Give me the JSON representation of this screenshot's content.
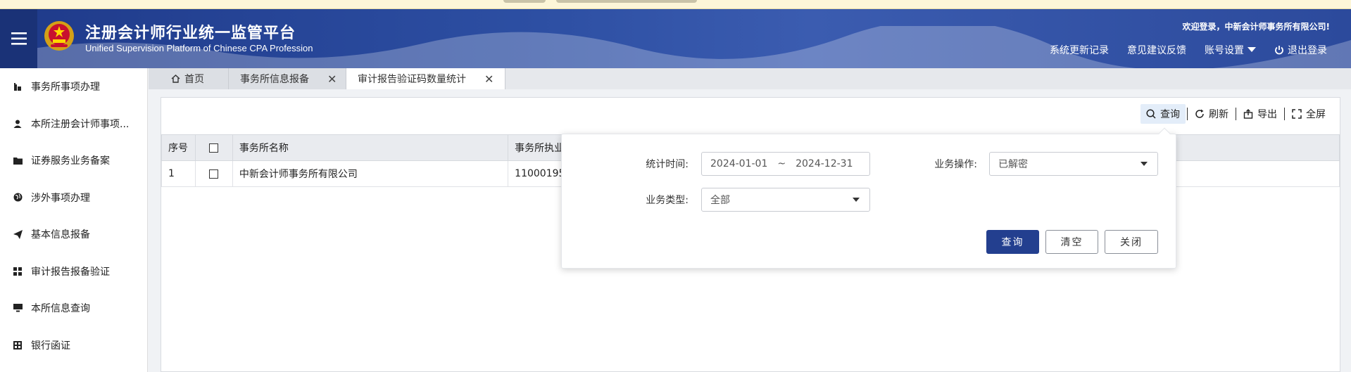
{
  "header": {
    "title_cn": "注册会计师行业统一监管平台",
    "title_en": "Unified Supervision Platform of Chinese CPA Profession",
    "welcome": "欢迎登录，中新会计师事务所有限公司!",
    "nav": [
      {
        "label": "系统更新记录"
      },
      {
        "label": "意见建议反馈"
      },
      {
        "label": "账号设置"
      },
      {
        "label": "退出登录"
      }
    ]
  },
  "sidebar": {
    "items": [
      {
        "label": "事务所事项办理",
        "icon": "building-icon"
      },
      {
        "label": "本所注册会计师事项...",
        "icon": "user-icon"
      },
      {
        "label": "证券服务业务备案",
        "icon": "folder-icon"
      },
      {
        "label": "涉外事项办理",
        "icon": "globe-icon"
      },
      {
        "label": "基本信息报备",
        "icon": "send-icon"
      },
      {
        "label": "审计报告报备验证",
        "icon": "grid-icon"
      },
      {
        "label": "本所信息查询",
        "icon": "monitor-icon"
      },
      {
        "label": "银行函证",
        "icon": "calculator-icon"
      }
    ]
  },
  "tabs": [
    {
      "label": "首页"
    },
    {
      "label": "事务所信息报备"
    },
    {
      "label": "审计报告验证码数量统计"
    }
  ],
  "toolbar": {
    "query": "查询",
    "refresh": "刷新",
    "export": "导出",
    "fullscreen": "全屏"
  },
  "table": {
    "headers": [
      "序号",
      "事务所名称",
      "事务所执业"
    ],
    "rows": [
      {
        "index": "1",
        "name": "中新会计师事务所有限公司",
        "license": "11000195"
      }
    ]
  },
  "popup": {
    "time_label": "统计时间:",
    "time_start": "2024-01-01",
    "time_sep": "~",
    "time_end": "2024-12-31",
    "op_label": "业务操作:",
    "op_value": "已解密",
    "type_label": "业务类型:",
    "type_value": "全部",
    "btn_query": "查询",
    "btn_clear": "清空",
    "btn_close": "关闭"
  },
  "colors": {
    "brand": "#233f8f",
    "header": "#2d4fa3",
    "highlight": "#e3edf9"
  }
}
